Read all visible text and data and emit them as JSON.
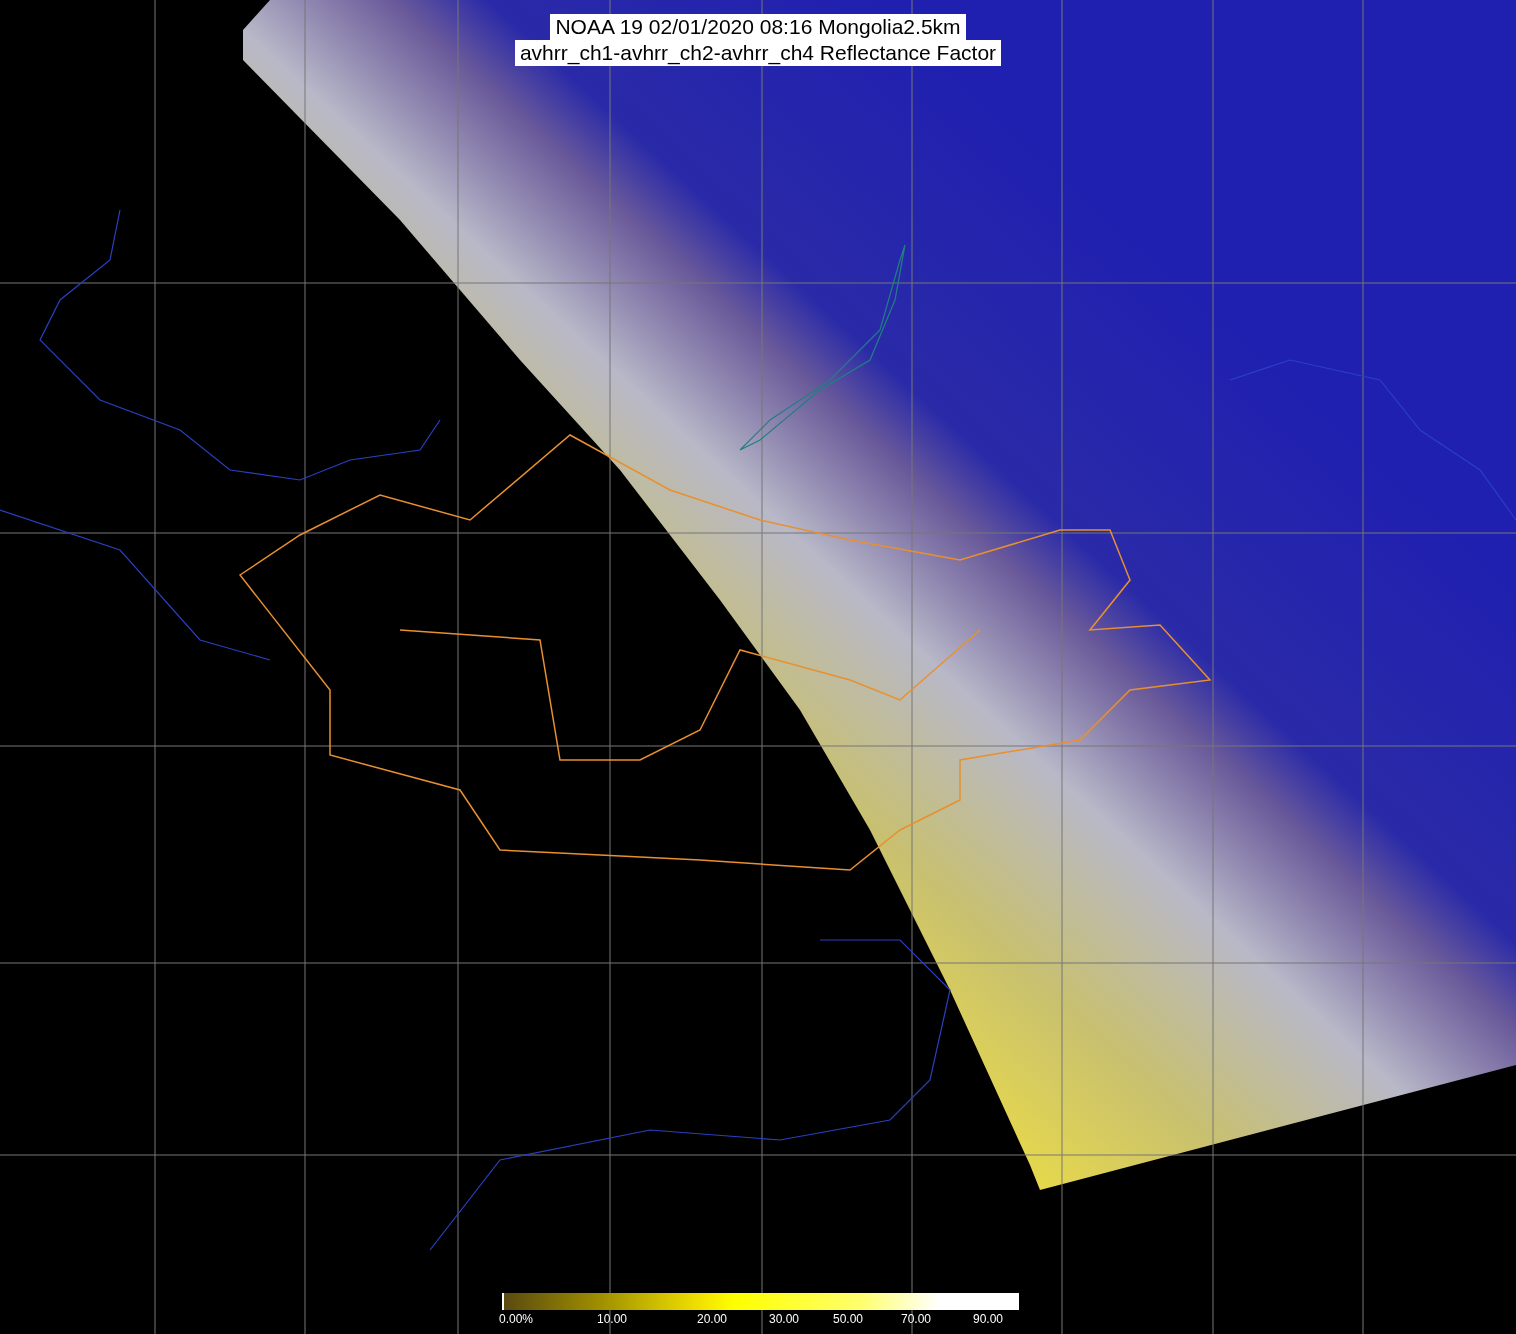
{
  "title": {
    "lines": [
      "NOAA 19 02/01/2020 08:16 Mongolia2.5km",
      "avhrr_ch1-avhrr_ch2-avhrr_ch4 Reflectance Factor"
    ]
  },
  "colorbar": {
    "labels": [
      "0.00%",
      "10.00",
      "20.00",
      "30.00",
      "50.00",
      "70.00",
      "90.00"
    ]
  }
}
